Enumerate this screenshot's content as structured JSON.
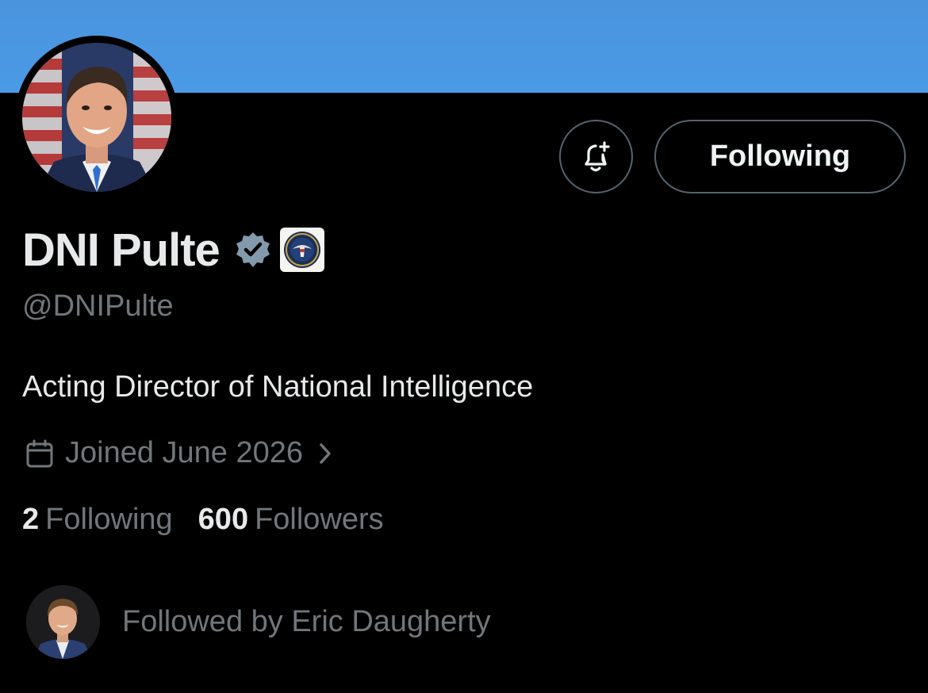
{
  "colors": {
    "banner": "#4a94dd",
    "background": "#000000",
    "primary_text": "#e7e9ea",
    "secondary_text": "#71767b",
    "button_border": "#536471",
    "verified_badge": "#829aab"
  },
  "profile": {
    "display_name": "DNI Pulte",
    "handle": "@DNIPulte",
    "bio": "Acting Director of National Intelligence",
    "joined": "Joined June 2026",
    "verified_icon": "verified-check-icon",
    "affiliation_icon": "seal-badge-icon"
  },
  "actions": {
    "notify_icon": "bell-plus-icon",
    "following_label": "Following"
  },
  "stats": {
    "following_count": "2",
    "following_label": "Following",
    "followers_count": "600",
    "followers_label": "Followers"
  },
  "followed_by": {
    "text": "Followed by Eric Daugherty"
  }
}
